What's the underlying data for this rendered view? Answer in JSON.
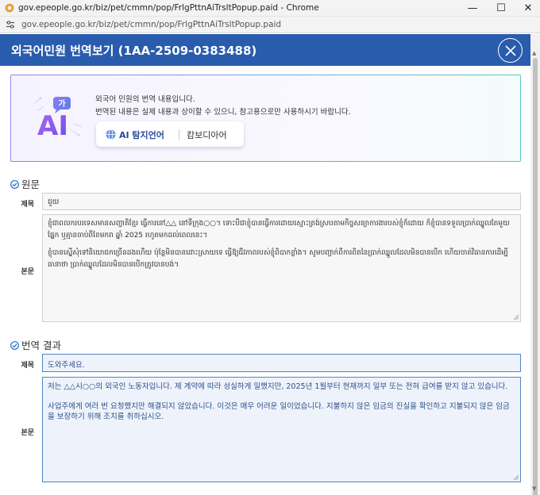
{
  "window": {
    "title": "gov.epeople.go.kr/biz/pet/cmmn/pop/FrlgPttnAiTrsltPopup.paid - Chrome",
    "url": "gov.epeople.go.kr/biz/pet/cmmn/pop/FrlgPttnAiTrsltPopup.paid",
    "minimize_label": "—",
    "maximize_label": "☐",
    "close_label": "✕"
  },
  "popup": {
    "title": "외국어민원 번역보기 (1AA-2509-0383488)"
  },
  "notice": {
    "logo_text": "AI",
    "logo_badge": "가",
    "line1": "외국어 민원의 번역 내용입니다.",
    "line2": "번역된 내용은 실제 내용과 상이할 수 있으니, 참고용으로만 사용하시기 바랍니다.",
    "detect_label": "AI 탐지언어",
    "detected_language": "캄보디아어"
  },
  "original": {
    "heading": "원문",
    "title_label": "제목",
    "title_value": "ជួយ",
    "body_label": "본문",
    "body_paragraphs": [
      "ខ្ញុំជាពលករបរទេសមានសញ្ជាតិខ្មែរ ធ្វើការនៅ△△ នៅទីក្រុង○○។ ទោះបីជាខ្ញុំបានធ្វើការដោយស្មោះត្រង់ស្របតាមកិច្ចសន្យាការងារបស់ខ្ញុំក៏ដោយ ក៏ខ្ញុំបានទទួលប្រាក់ឈ្នួលតែមួយផ្នែក ឬគ្មានចាប់ពីខែមករា ឆ្នាំ 2025 រហូតមកដល់ពេលនេះ។",
      "ខ្ញុំបានស្នើសុំទៅនិយោជកច្រើនដងហើយ ប៉ុន្តែមិនបានដោះស្រាយទេ ធ្វើឱ្យជីវភាពរបស់ខ្ញុំពិបាកខ្លាំង។ សូមបញ្ជាក់ពីការពិតនៃប្រាក់ឈ្នួលដែលមិនបានបើក ហើយចាត់វិធានការដើម្បីធានាថា ប្រាក់ឈ្នួលដែលមិនបានបើកត្រូវបានបង់។"
    ]
  },
  "translation": {
    "heading": "번역 결과",
    "title_label": "제목",
    "title_value": "도와주세요.",
    "body_label": "본문",
    "body_paragraphs": [
      "저는 △△시○○의 외국인 노동자입니다. 제 계약에 따라 성실하게 일했지만, 2025년 1월부터 현재까지 일부 또는 전혀 급여를 받지 않고 있습니다.",
      "사업주에게 여러 번 요청했지만 해결되지 않았습니다. 이것은 매우 어려운 일이었습니다. 지불하지 않은 임금의 진실을 확인하고 지불되지 않은 임금을 보장하기 위해 조치를 취하십시오."
    ]
  },
  "colors": {
    "header_blue": "#2a5cad",
    "field_border_blue": "#4f86c6",
    "translated_text": "#2c4f88",
    "section_check": "#1f6fd0"
  },
  "icons": {
    "favicon": "chrome-page-icon",
    "site_settings": "tune-icon",
    "close": "close-icon",
    "ai_logo": "ai-translate-icon",
    "globe": "globe-icon",
    "section": "check-circle-icon"
  }
}
